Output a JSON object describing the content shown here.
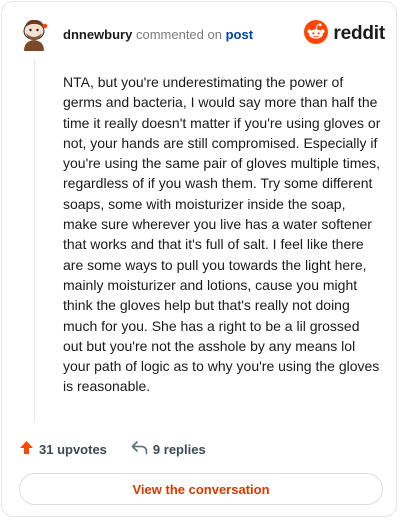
{
  "comment": {
    "username": "dnnewbury",
    "action_text": "commented on",
    "post_link": "post",
    "body": "NTA, but you're underestimating the power of germs and bacteria, I would say more than half the time it really doesn't matter if you're using gloves or not, your hands are still compromised. Especially if you're using the same pair of gloves multiple times, regardless of if you wash them. Try some different soaps, some with moisturizer inside the soap, make sure wherever you live has a water softener that works and that it's full of salt. I feel like there are some ways to pull you towards the light here, mainly moisturizer and lotions, cause you might think the gloves help but that's really not doing much for you. She has a right to be a lil grossed out but you're not the asshole by any means lol your path of logic as to why you're using the gloves is reasonable."
  },
  "brand": {
    "name": "reddit",
    "color": "#ff4500"
  },
  "stats": {
    "upvotes": "31 upvotes",
    "replies": "9 replies"
  },
  "cta_label": "View the conversation",
  "icons": {
    "upvote": "upvote-arrow-icon",
    "reply": "reply-arrow-icon",
    "logo": "reddit-snoo-icon",
    "avatar": "snoovatar"
  },
  "colors": {
    "upvote": "#ff4500",
    "link": "#0045ac",
    "cta": "#d93900"
  }
}
